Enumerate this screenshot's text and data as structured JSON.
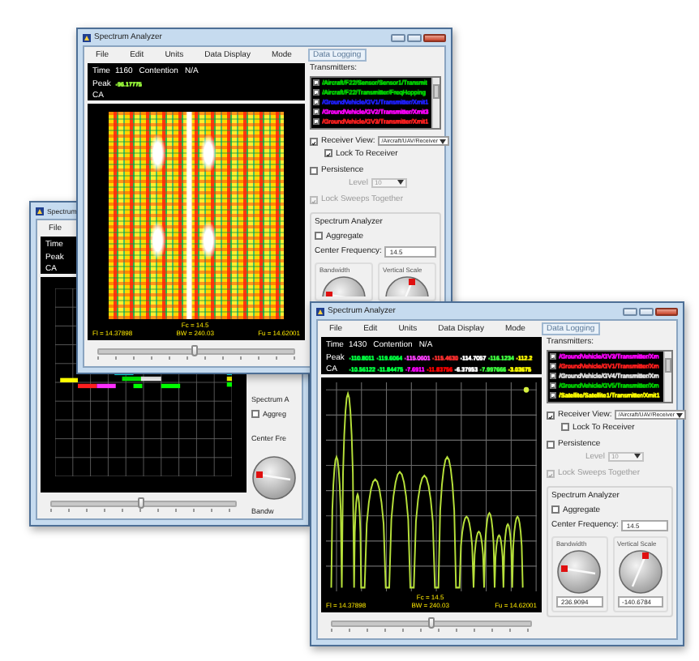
{
  "windows": [
    {
      "kind": "timeline",
      "title": "Spectrum",
      "menu": [
        {
          "label": "File",
          "selected": false
        }
      ],
      "readout": {
        "time_label": "Time",
        "peak_label": "Peak",
        "ca_label": "CA"
      },
      "slider": {
        "level": 0.49
      },
      "side": {
        "heading": "Spectrum A",
        "aggregate": {
          "label": "Aggreg",
          "checked": false
        },
        "center_frequency": "Center Fre",
        "bandwidth": "Bandw"
      }
    },
    {
      "kind": "spectrogram",
      "title": "Spectrum Analyzer",
      "menu": [
        {
          "label": "File",
          "selected": false
        },
        {
          "label": "Edit",
          "selected": false
        },
        {
          "label": "Units",
          "selected": false
        },
        {
          "label": "Data Display",
          "selected": false
        },
        {
          "label": "Mode",
          "selected": false
        },
        {
          "label": "Data Logging",
          "selected": true
        }
      ],
      "readout": {
        "time_label": "Time",
        "time": "1160",
        "contention_label": "Contention",
        "contention": "N/A",
        "peak_label": "Peak",
        "peak_values": [
          {
            "text": "-96.17775",
            "color": "#9cff3c"
          }
        ],
        "ca_label": "CA"
      },
      "plot_labels": {
        "fl": "Fl = 14.37898",
        "fc": "Fc = 14.5",
        "bw": "BW = 240.03",
        "fu": "Fu = 14.62001"
      },
      "slider": {
        "level": 0.49
      },
      "side": {
        "transmitters": {
          "label": "Transmitters:",
          "items": [
            {
              "text": "/Aircraft/F22/Sensor/Sensor1/Transmit",
              "color": "#00d000",
              "checked": true
            },
            {
              "text": "/Aircraft/F22/Transmitter/FreqHopping",
              "color": "#00d000",
              "checked": true
            },
            {
              "text": "/GroundVehicle/GV1/Transmitter/Xmit1",
              "color": "#2020ff",
              "checked": true
            },
            {
              "text": "/GroundVehicle/GV2/Transmitter/Xmit3",
              "color": "#ff00ff",
              "checked": true
            },
            {
              "text": "/GroundVehicle/GV3/Transmitter/Xmit1",
              "color": "#ff2020",
              "checked": true
            }
          ]
        },
        "receiver_view": {
          "label": "Receiver View:",
          "checked": true,
          "value": "/Aircraft/UAV/Receiver"
        },
        "lock_to_receiver": {
          "label": "Lock To Receiver",
          "checked": true
        },
        "persistence": {
          "label": "Persistence",
          "checked": false
        },
        "level": {
          "label": "Level",
          "value": "10",
          "disabled": true
        },
        "lock_sweeps": {
          "label": "Lock Sweeps Together",
          "checked": true,
          "disabled": true
        },
        "analyzer": {
          "title": "Spectrum Analyzer",
          "aggregate": {
            "label": "Aggregate",
            "checked": false
          },
          "center_frequency": {
            "label": "Center Frequency:",
            "value": "14.5"
          },
          "bandwidth": {
            "label": "Bandwidth"
          },
          "vertical_scale": {
            "label": "Vertical Scale"
          }
        }
      }
    },
    {
      "kind": "spectrum",
      "title": "Spectrum Analyzer",
      "menu": [
        {
          "label": "File",
          "selected": false
        },
        {
          "label": "Edit",
          "selected": false
        },
        {
          "label": "Units",
          "selected": false
        },
        {
          "label": "Data Display",
          "selected": false
        },
        {
          "label": "Mode",
          "selected": false
        },
        {
          "label": "Data Logging",
          "selected": true
        }
      ],
      "readout": {
        "time_label": "Time",
        "time": "1430",
        "contention_label": "Contention",
        "contention": "N/A",
        "peak_label": "Peak",
        "peak_values": [
          {
            "text": "-110.8011",
            "color": "#00ff40"
          },
          {
            "text": "-119.6064",
            "color": "#00ff40"
          },
          {
            "text": "-115.0601",
            "color": "#ff40ff"
          },
          {
            "text": "-115.4630",
            "color": "#ff3030"
          },
          {
            "text": "-114.7057",
            "color": "#ffffff"
          },
          {
            "text": "-116.1234",
            "color": "#40ff40"
          },
          {
            "text": "-112.2",
            "color": "#ffff00"
          }
        ],
        "ca_label": "CA",
        "ca_values": [
          {
            "text": "-10.56122",
            "color": "#00ff40"
          },
          {
            "text": "-11.84475",
            "color": "#00ff40"
          },
          {
            "text": "-7.6911",
            "color": "#ff00ff"
          },
          {
            "text": "-11.83756",
            "color": "#ff0000"
          },
          {
            "text": "-6.37953",
            "color": "#ffffff"
          },
          {
            "text": "-7.997666",
            "color": "#40ff40"
          },
          {
            "text": "-3.03675",
            "color": "#ffff00"
          }
        ]
      },
      "plot_labels": {
        "fl": "Fl = 14.37898",
        "fc": "Fc = 14.5",
        "bw": "BW = 240.03",
        "fu": "Fu = 14.62001"
      },
      "slider": {
        "level": 0.5
      },
      "side": {
        "transmitters": {
          "label": "Transmitters:",
          "items": [
            {
              "text": "/GroundVehicle/GV3/Transmitter/Xm",
              "color": "#ff00ff",
              "checked": true
            },
            {
              "text": "/GroundVehicle/GV1/Transmitter/Xm",
              "color": "#ff2020",
              "checked": true
            },
            {
              "text": "/GroundVehicle/GV4/Transmitter/Xm",
              "color": "#e0e0e0",
              "checked": true
            },
            {
              "text": "/GroundVehicle/GV5/Transmitter/Xm",
              "color": "#00d000",
              "checked": true
            },
            {
              "text": "/Satellite/Satellite1/Transmitter/Xmit1",
              "color": "#ffff00",
              "checked": true
            }
          ]
        },
        "receiver_view": {
          "label": "Receiver View:",
          "checked": true,
          "value": "/Aircraft/UAV/Receiver"
        },
        "lock_to_receiver": {
          "label": "Lock To Receiver",
          "checked": false
        },
        "persistence": {
          "label": "Persistence",
          "checked": false
        },
        "level": {
          "label": "Level",
          "value": "10",
          "disabled": true
        },
        "lock_sweeps": {
          "label": "Lock Sweeps Together",
          "checked": true,
          "disabled": true
        },
        "analyzer": {
          "title": "Spectrum Analyzer",
          "aggregate": {
            "label": "Aggregate",
            "checked": false
          },
          "center_frequency": {
            "label": "Center Frequency:",
            "value": "14.5"
          },
          "bandwidth": {
            "label": "Bandwidth",
            "value": "236.9094"
          },
          "vertical_scale": {
            "label": "Vertical Scale",
            "value": "-140.6784"
          }
        }
      }
    }
  ]
}
